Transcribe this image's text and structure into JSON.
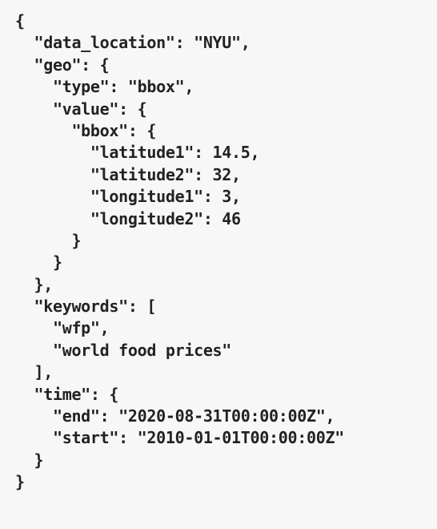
{
  "code": {
    "lines": [
      "{",
      "  \"data_location\": \"NYU\",",
      "  \"geo\": {",
      "    \"type\": \"bbox\",",
      "    \"value\": {",
      "      \"bbox\": {",
      "        \"latitude1\": 14.5,",
      "        \"latitude2\": 32,",
      "        \"longitude1\": 3,",
      "        \"longitude2\": 46",
      "      }",
      "    }",
      "  },",
      "  \"keywords\": [",
      "    \"wfp\",",
      "    \"world food prices\"",
      "  ],",
      "  \"time\": {",
      "    \"end\": \"2020-08-31T00:00:00Z\",",
      "    \"start\": \"2010-01-01T00:00:00Z\"",
      "  }",
      "}"
    ]
  }
}
